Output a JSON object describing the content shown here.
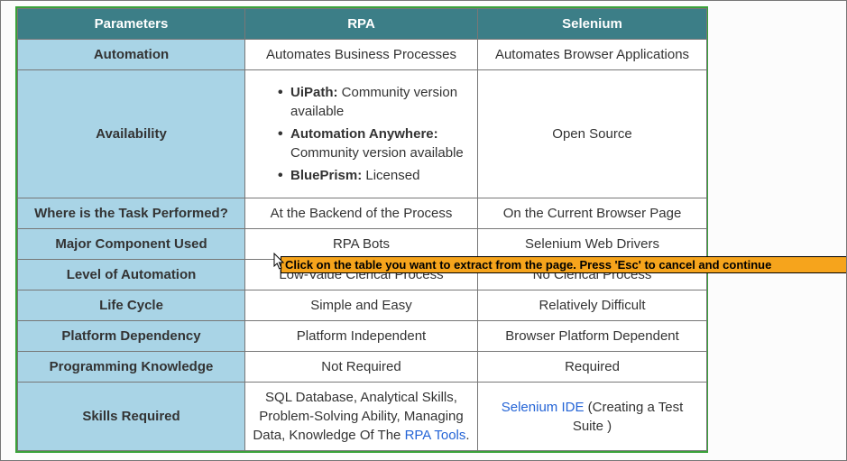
{
  "headers": {
    "param": "Parameters",
    "rpa": "RPA",
    "sel": "Selenium"
  },
  "rows": {
    "automation": {
      "param": "Automation",
      "rpa": "Automates Business Processes",
      "sel": "Automates Browser Applications"
    },
    "availability": {
      "param": "Availability",
      "rpa_items": [
        {
          "bold": "UiPath:",
          "text": " Community version available"
        },
        {
          "bold": "Automation Anywhere:",
          "text": " Community version available"
        },
        {
          "bold": "BluePrism:",
          "text": " Licensed"
        }
      ],
      "sel": "Open Source"
    },
    "task_performed": {
      "param": "Where is the Task Performed?",
      "rpa": "At the Backend of the Process",
      "sel": "On the Current Browser Page"
    },
    "major_component": {
      "param": "Major Component Used",
      "rpa": "RPA Bots",
      "sel": "Selenium Web Drivers"
    },
    "level_automation": {
      "param": "Level of Automation",
      "rpa": "Low-Value Clerical Process",
      "sel": "No Clerical Process"
    },
    "life_cycle": {
      "param": "Life Cycle",
      "rpa": "Simple and Easy",
      "sel": "Relatively Difficult"
    },
    "platform_dep": {
      "param": "Platform Dependency",
      "rpa": "Platform Independent",
      "sel": "Browser Platform Dependent"
    },
    "prog_knowledge": {
      "param": "Programming Knowledge",
      "rpa": "Not Required",
      "sel": "Required"
    },
    "skills": {
      "param": "Skills Required",
      "rpa_pre": "SQL Database, Analytical Skills, Problem-Solving Ability, Managing Data, Knowledge Of The ",
      "rpa_link": "RPA Tools",
      "rpa_post": ".",
      "sel_link": "Selenium IDE",
      "sel_post": " (Creating a Test Suite )"
    }
  },
  "overlay": "Click on the table you want to extract from the page. Press 'Esc' to cancel and continue"
}
